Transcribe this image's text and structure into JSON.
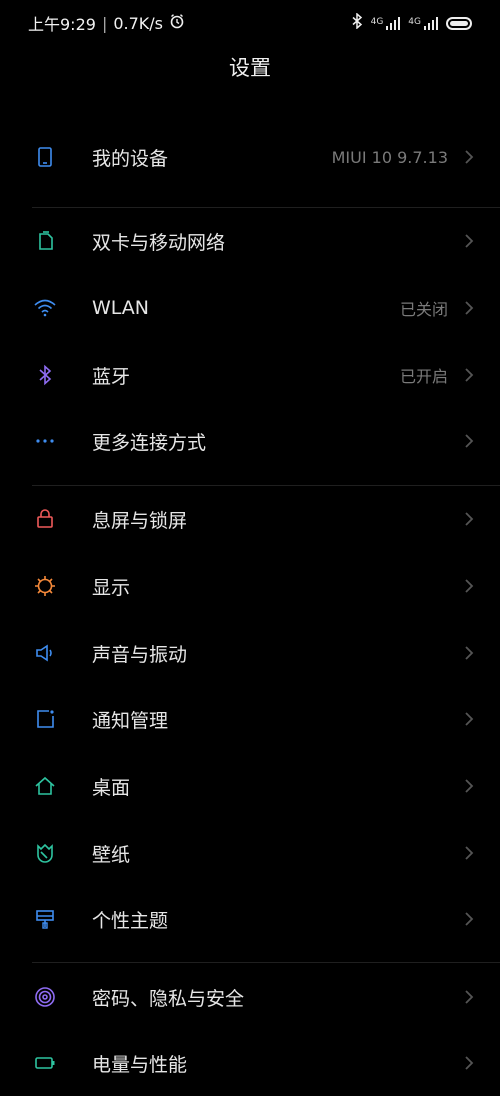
{
  "status_bar": {
    "time": "上午9:29",
    "separator": "|",
    "speed": "0.7K/s",
    "network_1": "4G",
    "network_2": "4G"
  },
  "header": {
    "title": "设置"
  },
  "settings": {
    "my_device": {
      "label": "我的设备",
      "value": "MIUI 10 9.7.13",
      "icon": "phone-icon",
      "color": "#3f8df0"
    },
    "dual_sim": {
      "label": "双卡与移动网络",
      "icon": "sim-card-icon",
      "color": "#2ec4a0"
    },
    "wlan": {
      "label": "WLAN",
      "value": "已关闭",
      "icon": "wifi-icon",
      "color": "#3f8df0"
    },
    "bluetooth": {
      "label": "蓝牙",
      "value": "已开启",
      "icon": "bluetooth-icon",
      "color": "#8e6cf2"
    },
    "more_connect": {
      "label": "更多连接方式",
      "icon": "more-dots-icon",
      "color": "#3f8df0"
    },
    "lock_screen": {
      "label": "息屏与锁屏",
      "icon": "lock-icon",
      "color": "#ef5a5a"
    },
    "display": {
      "label": "显示",
      "icon": "sun-icon",
      "color": "#f5893a"
    },
    "sound": {
      "label": "声音与振动",
      "icon": "speaker-icon",
      "color": "#3f8df0"
    },
    "notifications": {
      "label": "通知管理",
      "icon": "notification-icon",
      "color": "#3f8df0"
    },
    "home_screen": {
      "label": "桌面",
      "icon": "home-icon",
      "color": "#2ec4a0"
    },
    "wallpaper": {
      "label": "壁纸",
      "icon": "wallpaper-icon",
      "color": "#2ec4a0"
    },
    "themes": {
      "label": "个性主题",
      "icon": "theme-brush-icon",
      "color": "#3f8df0"
    },
    "security": {
      "label": "密码、隐私与安全",
      "icon": "fingerprint-icon",
      "color": "#8e6cf2"
    },
    "battery": {
      "label": "电量与性能",
      "icon": "battery-icon",
      "color": "#2ec4a0"
    }
  }
}
